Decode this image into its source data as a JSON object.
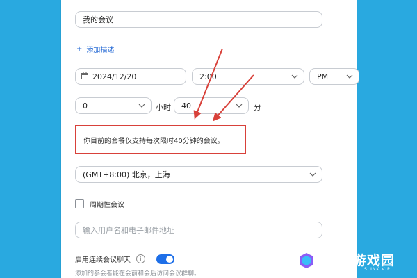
{
  "meeting": {
    "title_value": "我的会议",
    "add_description_label": "添加描述",
    "date_value": "2024/12/20",
    "time_value": "2:00",
    "ampm_value": "PM",
    "hours_value": "0",
    "hours_unit": "小时",
    "minutes_value": "40",
    "minutes_unit": "分",
    "warning_text": "你目前的套餐仅支持每次限时40分钟的会议。",
    "timezone_value": "(GMT+8:00) 北京，上海",
    "recurring_label": "周期性会议",
    "invitee_placeholder": "输入用户名和电子邮件地址",
    "continuous_chat_label": "启用连续会议聊天",
    "continuous_chat_hint": "添加的参会者能在会前和会后访问会议群聊。"
  },
  "watermark": {
    "logo_text": "速链游戏园",
    "logo_subtext": "SLINK.VIP"
  },
  "colors": {
    "background": "#29a9e0",
    "accent_blue": "#1e6fe8",
    "warning_red": "#d8413a"
  }
}
